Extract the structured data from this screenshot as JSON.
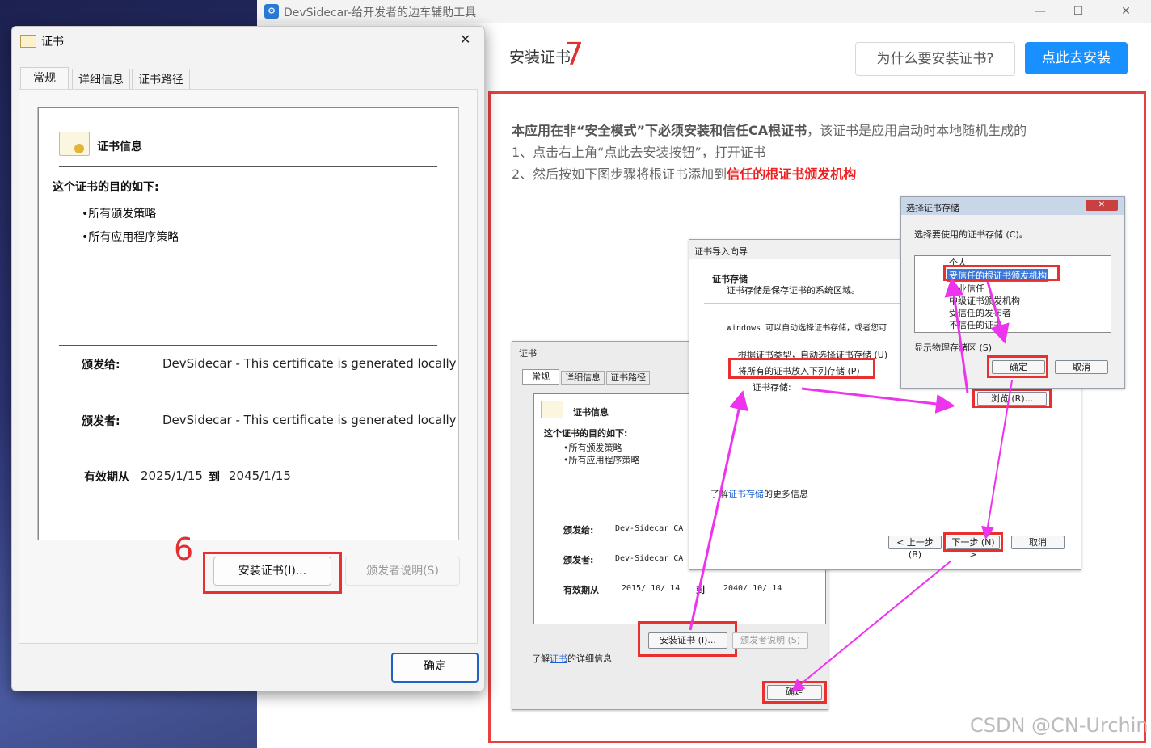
{
  "app": {
    "title": "DevSidecar-给开发者的边车辅助工具",
    "page_heading": "安装证书",
    "step_7": "7",
    "why_button": "为什么要安装证书?",
    "install_button": "点此去安装",
    "minimize": "—",
    "maximize": "☐",
    "close": "✕"
  },
  "instructions": {
    "line1_bold": "本应用在非“安全模式”下必须安装和信任CA根证书",
    "line1_rest": "，该证书是应用启动时本地随机生成的",
    "line2": "1、点击右上角“点此去安装按钮”，打开证书",
    "line3_prefix": "2、然后按如下图步骤将根证书添加到",
    "line3_red": "信任的根证书颁发机构"
  },
  "guide": {
    "store_dialog": {
      "title": "选择证书存储",
      "prompt": "选择要使用的证书存储 (C)。",
      "items": [
        "个人",
        "受信任的根证书颁发机构",
        "企业信任",
        "中级证书颁发机构",
        "受信任的发布者",
        "不信任的证书"
      ],
      "show_physical": "显示物理存储区 (S)",
      "ok": "确定",
      "cancel": "取消"
    },
    "import_wizard": {
      "title": "证书导入向导",
      "section": "证书存储",
      "section_desc": "证书存储是保存证书的系统区域。",
      "auto_text": "Windows 可以自动选择证书存储，或者您可",
      "radio_auto": "根据证书类型，自动选择证书存储 (U)",
      "radio_manual": "将所有的证书放入下列存储 (P)",
      "store_label": "证书存储:",
      "browse": "浏览 (R)...",
      "learn_prefix": "了解",
      "learn_link": "证书存储",
      "learn_suffix": "的更多信息",
      "back": "< 上一步 (B)",
      "next": "下一步 (N) >",
      "cancel": "取消"
    },
    "mini_cert": {
      "title": "证书",
      "tabs": [
        "常规",
        "详细信息",
        "证书路径"
      ],
      "info_title": "证书信息",
      "purpose": "这个证书的目的如下:",
      "bullets": [
        "•所有颁发策略",
        "•所有应用程序策略"
      ],
      "issued_to_label": "颁发给:",
      "issued_to": "Dev-Sidecar CA",
      "issued_by_label": "颁发者:",
      "issued_by": "Dev-Sidecar CA",
      "valid_label": "有效期从",
      "valid_from": "2015/ 10/ 14",
      "to": "到",
      "valid_to": "2040/ 10/ 14",
      "install": "安装证书 (I)...",
      "issuer_stmt": "颁发者说明 (S)",
      "learn_prefix": "了解",
      "learn_link": "证书",
      "learn_suffix": "的详细信息",
      "ok": "确定"
    }
  },
  "cert_dialog": {
    "title": "证书",
    "tabs": [
      "常规",
      "详细信息",
      "证书路径"
    ],
    "info_title": "证书信息",
    "purpose": "这个证书的目的如下:",
    "bullets": [
      "•所有颁发策略",
      "•所有应用程序策略"
    ],
    "issued_to_label": "颁发给:",
    "issued_to": "DevSidecar - This certificate is generated locally",
    "issued_by_label": "颁发者:",
    "issued_by": "DevSidecar - This certificate is generated locally",
    "valid_label": "有效期从",
    "valid_from": "2025/1/15",
    "to": "到",
    "valid_to": "2045/1/15",
    "step_6": "6",
    "install_button": "安装证书(I)...",
    "issuer_button": "颁发者说明(S)",
    "ok_button": "确定",
    "close": "✕"
  },
  "watermark": "CSDN @CN-Urchin",
  "colors": {
    "accent": "#1890ff",
    "annotation_red": "#e83030",
    "arrow_magenta": "#ee33ee"
  }
}
